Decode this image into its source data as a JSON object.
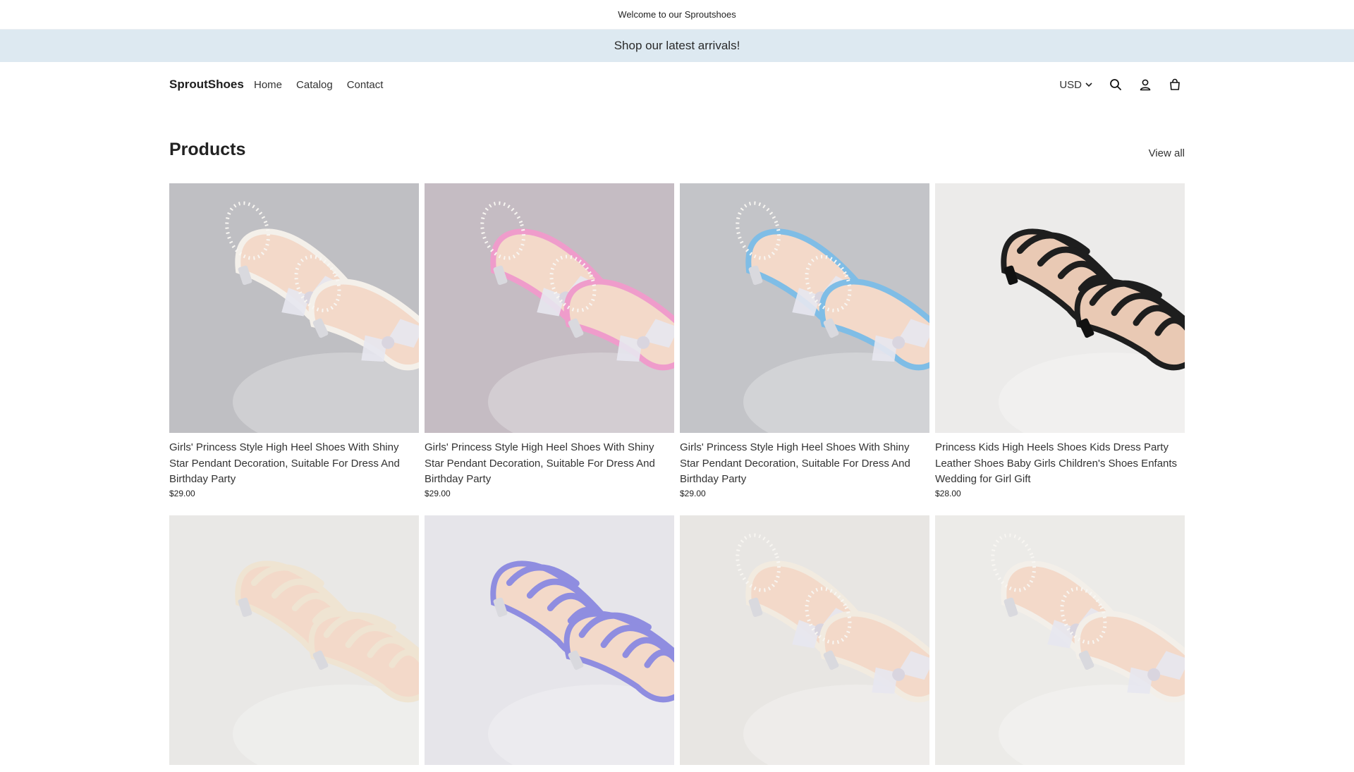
{
  "announcement": "Welcome to our Sproutshoes",
  "promo": "Shop our latest arrivals!",
  "header": {
    "brand": "SproutShoes",
    "nav": [
      "Home",
      "Catalog",
      "Contact"
    ],
    "currency": "USD",
    "icons": [
      "search-icon",
      "account-icon",
      "cart-icon"
    ]
  },
  "section": {
    "title": "Products",
    "view_all": "View all"
  },
  "colors": {
    "promo_bg": "#dde9f1",
    "text": "#1f1f1f"
  },
  "products": [
    {
      "title": "Girls' Princess Style High Heel Shoes With Shiny Star Pendant Decoration, Suitable For Dress And Birthday Party",
      "price": "$29.00",
      "shoe_color": "#f4f0ea",
      "bg": "#bfbfc3",
      "style": "bow"
    },
    {
      "title": "Girls' Princess Style High Heel Shoes With Shiny Star Pendant Decoration, Suitable For Dress And Birthday Party",
      "price": "$29.00",
      "shoe_color": "#ef9ccb",
      "bg": "#c5bcc3",
      "style": "bow"
    },
    {
      "title": "Girls' Princess Style High Heel Shoes With Shiny Star Pendant Decoration, Suitable For Dress And Birthday Party",
      "price": "$29.00",
      "shoe_color": "#7fbde6",
      "bg": "#c3c4c8",
      "style": "bow"
    },
    {
      "title": "Princess Kids High Heels Shoes Kids Dress Party Leather Shoes Baby Girls Children's Shoes Enfants Wedding for Girl Gift",
      "price": "$28.00",
      "shoe_color": "#1e1e1e",
      "bg": "#ecebea",
      "style": "strappy"
    },
    {
      "title": "",
      "price": "",
      "shoe_color": "#efe4d2",
      "bg": "#e9e8e6",
      "style": "strappy"
    },
    {
      "title": "",
      "price": "",
      "shoe_color": "#8f8de0",
      "bg": "#e6e5ea",
      "style": "strappy"
    },
    {
      "title": "",
      "price": "",
      "shoe_color": "#f2ebe0",
      "bg": "#e8e6e3",
      "style": "bow"
    },
    {
      "title": "",
      "price": "",
      "shoe_color": "#f3efe9",
      "bg": "#ecebe8",
      "style": "bow"
    }
  ]
}
